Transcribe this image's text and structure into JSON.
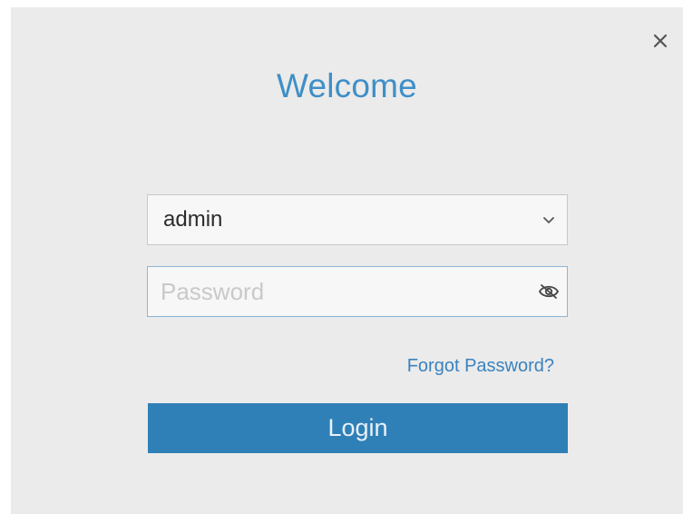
{
  "dialog": {
    "title": "Welcome",
    "close_icon": "close-icon"
  },
  "username": {
    "value": "admin",
    "dropdown_icon": "chevron-down-icon"
  },
  "password": {
    "placeholder": "Password",
    "value": "",
    "visibility_icon": "eye-slash-icon"
  },
  "forgot_password_label": "Forgot Password?",
  "login_label": "Login",
  "colors": {
    "accent": "#3f8fc6",
    "button": "#2f80b7",
    "background": "#ebebeb"
  }
}
